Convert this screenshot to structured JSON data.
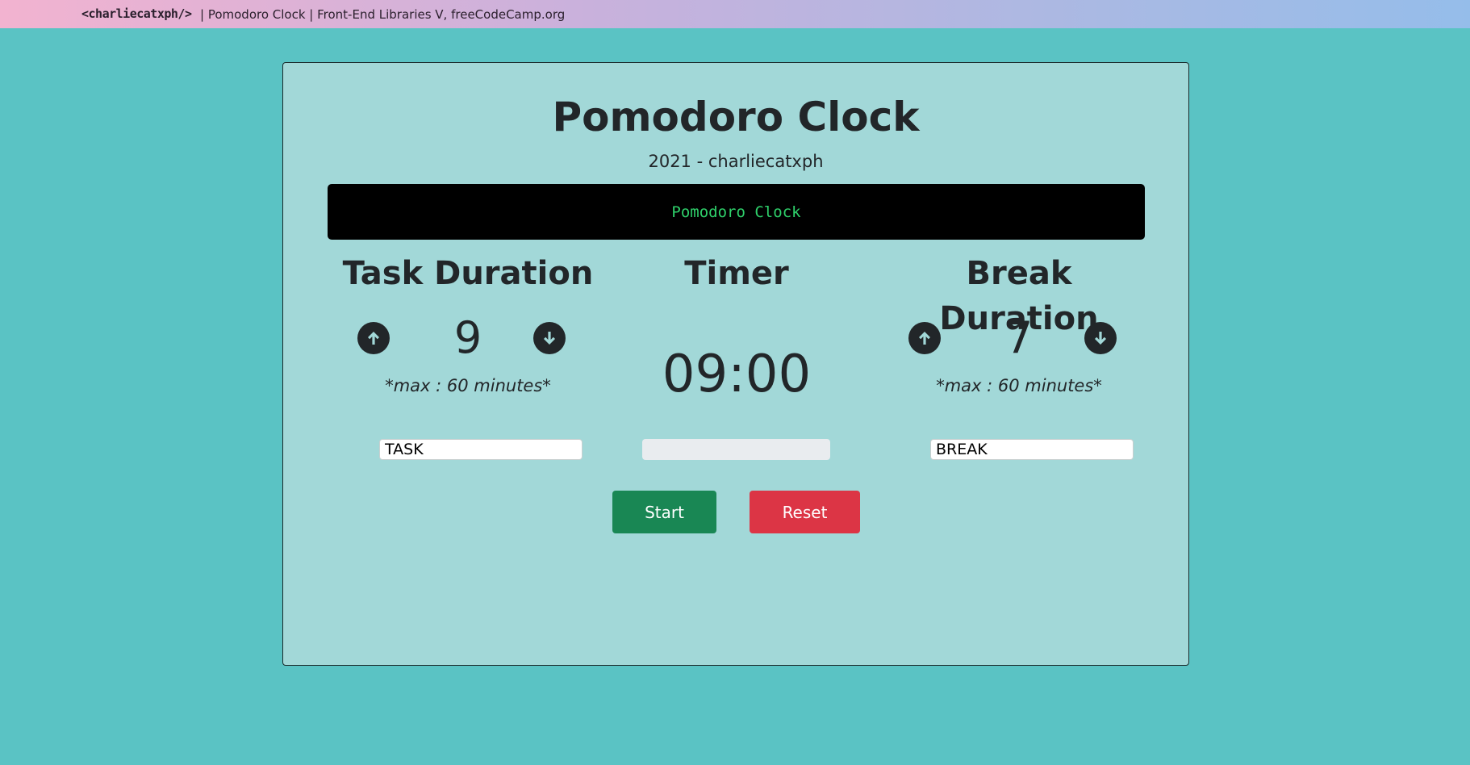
{
  "topbar": {
    "brand": "<charliecatxph/>",
    "meta": "| Pomodoro Clock | Front-End Libraries V, freeCodeCamp.org"
  },
  "card": {
    "title": "Pomodoro Clock",
    "subtitle": "2021 - charliecatxph",
    "display_text": "Pomodoro Clock"
  },
  "task": {
    "heading": "Task Duration",
    "value": "9",
    "hint": "*max : 60 minutes*",
    "label_value": "TASK",
    "up_icon": "arrow-up-circle-icon",
    "down_icon": "arrow-down-circle-icon"
  },
  "timer": {
    "heading": "Timer",
    "time": "09:00",
    "progress": 0
  },
  "break": {
    "heading": "Break Duration",
    "value": "7",
    "hint": "*max : 60 minutes*",
    "label_value": "BREAK",
    "up_icon": "arrow-up-circle-icon",
    "down_icon": "arrow-down-circle-icon"
  },
  "buttons": {
    "start": "Start",
    "reset": "Reset"
  },
  "colors": {
    "background": "#5ac3c4",
    "card": "#a2d8d8",
    "display_text": "#2fd16b",
    "start": "#198754",
    "reset": "#dc3545"
  }
}
